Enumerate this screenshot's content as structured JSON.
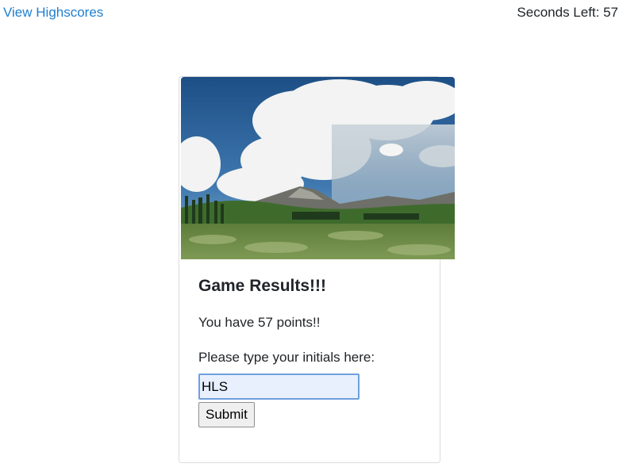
{
  "header": {
    "highscores_link": "View Highscores",
    "timer_text": "Seconds Left: 57"
  },
  "card": {
    "image_alt": "landscape-photo",
    "title": "Game Results!!!",
    "points_text": "You have 57 points!!",
    "prompt_text": "Please type your initials here:",
    "initials_value": "HLS",
    "submit_label": "Submit"
  },
  "colors": {
    "link": "#1e7fd0",
    "text": "#212529",
    "input_border": "#6ea0dc",
    "input_bg": "#e8f0fe"
  }
}
